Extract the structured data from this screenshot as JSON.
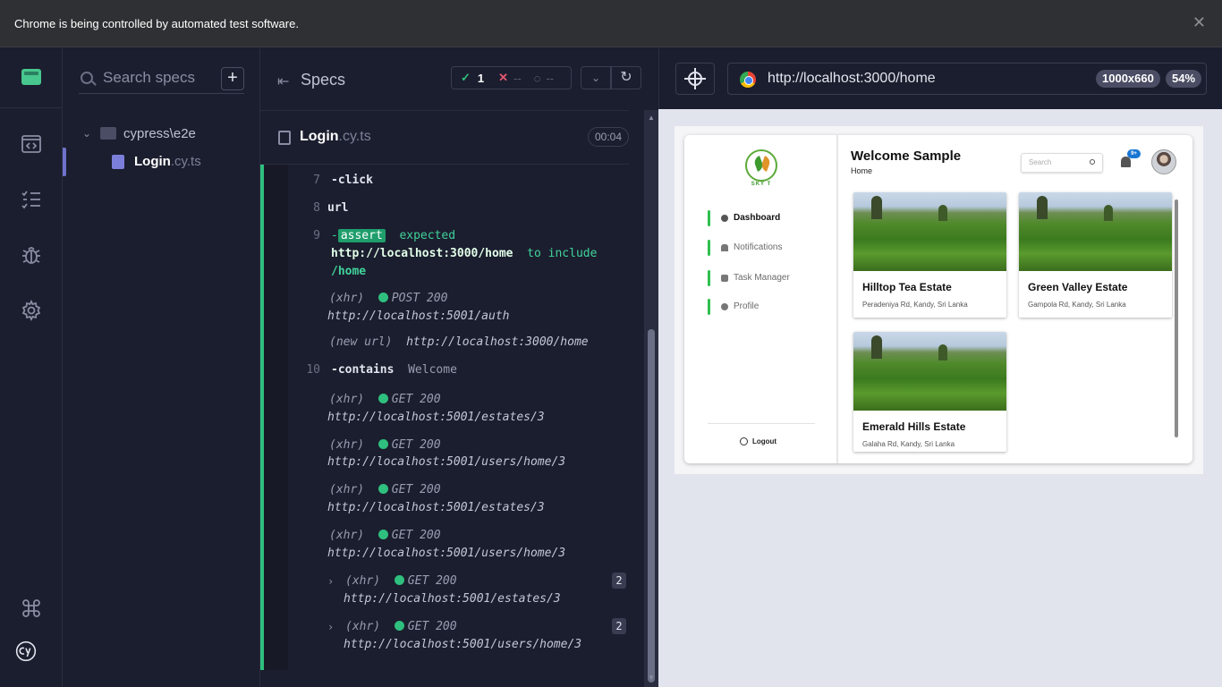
{
  "chrome_banner": {
    "text": "Chrome is being controlled by automated test software.",
    "close": "✕"
  },
  "left_nav": {
    "items": [
      "app-logo-icon",
      "code-icon",
      "list-check-icon",
      "bug-icon",
      "gear-icon",
      "command-icon",
      "cypress-logo-icon"
    ]
  },
  "specs_panel": {
    "search_placeholder": "Search specs",
    "add_label": "+",
    "folder": "cypress\\e2e",
    "spec_name": "Login",
    "spec_ext": ".cy.ts"
  },
  "reporter": {
    "title": "Specs",
    "passed_count": "1",
    "failed_count": "--",
    "pending_count": "--",
    "file_name": "Login",
    "file_ext": ".cy.ts",
    "duration": "00:04",
    "commands": [
      {
        "num": "7",
        "name": "-click"
      },
      {
        "num": "8",
        "name": "url"
      },
      {
        "num": "9",
        "name": "-",
        "tag": "assert",
        "msg1": "expected",
        "msg2": "http://localhost:3000/home",
        "msg3": "to include",
        "msg4": "/home"
      },
      {
        "type": "(xhr)",
        "method": "POST 200",
        "url": "http://localhost:5001/auth"
      },
      {
        "type": "(new url)",
        "url": "http://localhost:3000/home"
      },
      {
        "num": "10",
        "name": "-contains",
        "arg": "Welcome"
      },
      {
        "type": "(xhr)",
        "method": "GET 200",
        "url": "http://localhost:5001/estates/3"
      },
      {
        "type": "(xhr)",
        "method": "GET 200",
        "url": "http://localhost:5001/users/home/3"
      },
      {
        "type": "(xhr)",
        "method": "GET 200",
        "url": "http://localhost:5001/estates/3"
      },
      {
        "type": "(xhr)",
        "method": "GET 200",
        "url": "http://localhost:5001/users/home/3"
      },
      {
        "type": "(xhr)",
        "method": "GET 200",
        "url": "http://localhost:5001/estates/3",
        "count": "2"
      },
      {
        "type": "(xhr)",
        "method": "GET 200",
        "url": "http://localhost:5001/users/home/3",
        "count": "2"
      }
    ]
  },
  "aut": {
    "url": "http://localhost:3000/home",
    "viewport": "1000x660",
    "zoom": "54%"
  },
  "app": {
    "brand": "SKY T",
    "nav": [
      "Dashboard",
      "Notifications",
      "Task Manager",
      "Profile"
    ],
    "logout": "Logout",
    "welcome": "Welcome Sample",
    "breadcrumb": "Home",
    "search_placeholder": "Search",
    "badge": "9+",
    "estates": [
      {
        "name": "Hilltop Tea Estate",
        "address": "Peradeniya Rd, Kandy, Sri Lanka"
      },
      {
        "name": "Green Valley Estate",
        "address": "Gampola Rd, Kandy, Sri Lanka"
      },
      {
        "name": "Emerald Hills Estate",
        "address": "Galaha Rd, Kandy, Sri Lanka"
      }
    ]
  },
  "colors": {
    "pass": "#2fbf7e",
    "fail": "#e45770",
    "accent": "#6f72c9"
  }
}
